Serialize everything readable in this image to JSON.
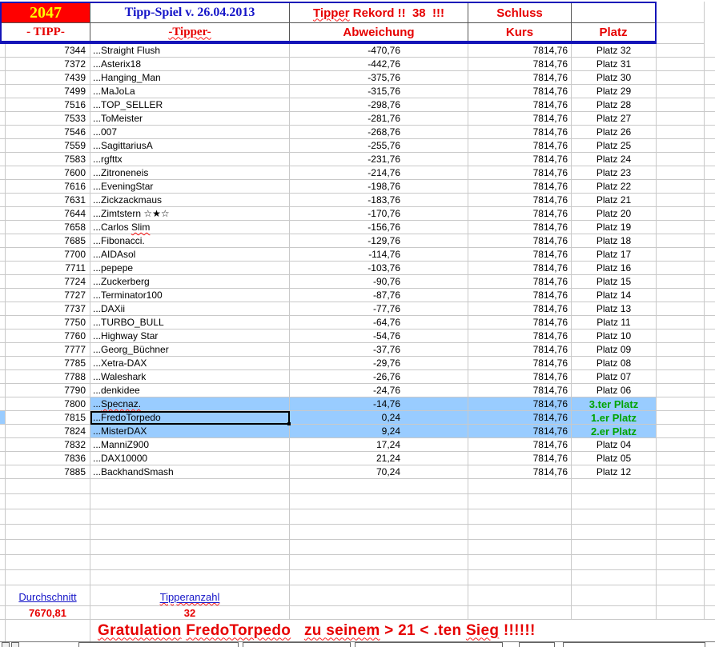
{
  "header": {
    "game_number": "2047",
    "title": "Tipp-Spiel v. 26.04.2013",
    "record_wavy": "Tipper",
    "record_rest": " Rekord !!  38  !!!",
    "schluss": "Schluss",
    "col_tipp": "- TIPP-",
    "col_tipper": "-Tipper-",
    "col_abweichung": "Abweichung",
    "col_kurs": "Kurs",
    "col_platz": "Platz"
  },
  "colors": {
    "header_cell_bg": "#ff0000",
    "header_cell_text": "#ffff00",
    "accent_red": "#e60000",
    "link_blue": "#1616c8",
    "border_blue": "#1414b8",
    "highlight_blue": "#99ccff",
    "winner_green": "#00a400"
  },
  "rows": [
    {
      "tipp": "7344",
      "name": "...Straight Flush",
      "abw": "-470,76",
      "kurs": "7814,76",
      "platz": "Platz 32"
    },
    {
      "tipp": "7372",
      "name": "...Asterix18",
      "abw": "-442,76",
      "kurs": "7814,76",
      "platz": "Platz 31"
    },
    {
      "tipp": "7439",
      "name": "...Hanging_Man",
      "abw": "-375,76",
      "kurs": "7814,76",
      "platz": "Platz 30"
    },
    {
      "tipp": "7499",
      "name": "...MaJoLa",
      "abw": "-315,76",
      "kurs": "7814,76",
      "platz": "Platz 29"
    },
    {
      "tipp": "7516",
      "name": "...TOP_SELLER",
      "abw": "-298,76",
      "kurs": "7814,76",
      "platz": "Platz 28"
    },
    {
      "tipp": "7533",
      "name": "...ToMeister",
      "abw": "-281,76",
      "kurs": "7814,76",
      "platz": "Platz 27"
    },
    {
      "tipp": "7546",
      "name": "...007",
      "abw": "-268,76",
      "kurs": "7814,76",
      "platz": "Platz 26"
    },
    {
      "tipp": "7559",
      "name": "...SagittariusA",
      "abw": "-255,76",
      "kurs": "7814,76",
      "platz": "Platz 25"
    },
    {
      "tipp": "7583",
      "name": "...rgfttx",
      "abw": "-231,76",
      "kurs": "7814,76",
      "platz": "Platz 24"
    },
    {
      "tipp": "7600",
      "name": "...Zitroneneis",
      "abw": "-214,76",
      "kurs": "7814,76",
      "platz": "Platz 23"
    },
    {
      "tipp": "7616",
      "name": "...EveningStar",
      "abw": "-198,76",
      "kurs": "7814,76",
      "platz": "Platz 22"
    },
    {
      "tipp": "7631",
      "name": "...Zickzackmaus",
      "abw": "-183,76",
      "kurs": "7814,76",
      "platz": "Platz 21"
    },
    {
      "tipp": "7644",
      "name": "...Zimtstern ☆★☆",
      "abw": "-170,76",
      "kurs": "7814,76",
      "platz": "Platz 20"
    },
    {
      "tipp": "7658",
      "name": "...Carlos ",
      "name_wavy": "Slim",
      "abw": "-156,76",
      "kurs": "7814,76",
      "platz": "Platz 19"
    },
    {
      "tipp": "7685",
      "name": "...Fibonacci.",
      "abw": "-129,76",
      "kurs": "7814,76",
      "platz": "Platz 18"
    },
    {
      "tipp": "7700",
      "name": "...AIDAsol",
      "abw": "-114,76",
      "kurs": "7814,76",
      "platz": "Platz 17"
    },
    {
      "tipp": "7711",
      "name": "...pepepe",
      "abw": "-103,76",
      "kurs": "7814,76",
      "platz": "Platz 16"
    },
    {
      "tipp": "7724",
      "name": "...Zuckerberg",
      "abw": "-90,76",
      "kurs": "7814,76",
      "platz": "Platz 15"
    },
    {
      "tipp": "7727",
      "name": "...Terminator100",
      "abw": "-87,76",
      "kurs": "7814,76",
      "platz": "Platz 14"
    },
    {
      "tipp": "7737",
      "name": "...DAXii",
      "abw": "-77,76",
      "kurs": "7814,76",
      "platz": "Platz 13"
    },
    {
      "tipp": "7750",
      "name": "...TURBO_BULL",
      "abw": "-64,76",
      "kurs": "7814,76",
      "platz": "Platz 11"
    },
    {
      "tipp": "7760",
      "name": "...Highway Star",
      "abw": "-54,76",
      "kurs": "7814,76",
      "platz": "Platz 10"
    },
    {
      "tipp": "7777",
      "name": "...Georg_Büchner",
      "abw": "-37,76",
      "kurs": "7814,76",
      "platz": "Platz 09"
    },
    {
      "tipp": "7785",
      "name": "...Xetra-DAX",
      "abw": "-29,76",
      "kurs": "7814,76",
      "platz": "Platz 08"
    },
    {
      "tipp": "7788",
      "name": "...Waleshark",
      "abw": "-26,76",
      "kurs": "7814,76",
      "platz": "Platz 07"
    },
    {
      "tipp": "7790",
      "name": "...denkidee",
      "abw": "-24,76",
      "kurs": "7814,76",
      "platz": "Platz 06"
    },
    {
      "tipp": "7800",
      "name": "...",
      "name_wavy": "Specnaz.",
      "abw": "-14,76",
      "kurs": "7814,76",
      "platz": "3.ter Platz",
      "highlight": true,
      "green": true
    },
    {
      "tipp": "7815",
      "name": "...FredoTorpedo",
      "abw": "0,24",
      "kurs": "7814,76",
      "platz": "1.er Platz",
      "highlight": true,
      "green": true,
      "selected": true
    },
    {
      "tipp": "7824",
      "name": "...MisterDAX",
      "abw": "9,24",
      "kurs": "7814,76",
      "platz": "2.er Platz",
      "highlight": true,
      "green": true
    },
    {
      "tipp": "7832",
      "name": "...ManniZ900",
      "abw": "17,24",
      "kurs": "7814,76",
      "platz": "Platz 04"
    },
    {
      "tipp": "7836",
      "name": "...DAX10000",
      "abw": "21,24",
      "kurs": "7814,76",
      "platz": "Platz 05"
    },
    {
      "tipp": "7885",
      "name": "...BackhandSmash",
      "abw": "70,24",
      "kurs": "7814,76",
      "platz": "Platz 12"
    }
  ],
  "empty_row_count": 7,
  "footer": {
    "durchschnitt_label": "Durchschnitt",
    "durchschnitt_value": "7670,81",
    "tipperanzahl_label": "Tipperanzahl",
    "tipperanzahl_value": "32",
    "gratulation_segments": [
      {
        "text": "Gratulation",
        "wavy": true
      },
      {
        "text": " ",
        "wavy": false
      },
      {
        "text": "FredoTorpedo",
        "wavy": true
      },
      {
        "text": "   ",
        "wavy": false
      },
      {
        "text": "zu seinem",
        "wavy": true
      },
      {
        "text": " > 21 < .ten ",
        "wavy": false
      },
      {
        "text": "Sieg",
        "wavy": true
      },
      {
        "text": " !!!!!!",
        "wavy": false
      }
    ]
  }
}
